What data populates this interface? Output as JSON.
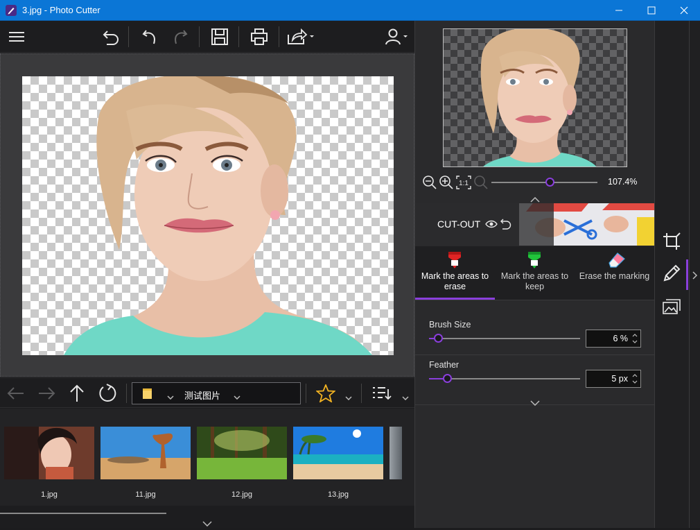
{
  "window": {
    "title": "3.jpg - Photo Cutter",
    "app_icon": "photo-cutter-pen-icon"
  },
  "toolbar": {
    "icons": [
      "menu-icon",
      "undo-all-icon",
      "undo-icon",
      "redo-icon",
      "save-icon",
      "print-icon",
      "share-icon",
      "user-icon"
    ]
  },
  "navigation": {
    "folder_name": "测试图片",
    "icons": [
      "back-arrow-icon",
      "forward-arrow-icon",
      "up-arrow-icon",
      "refresh-icon",
      "folder-icon",
      "star-icon",
      "sort-icon"
    ]
  },
  "thumbnails": [
    {
      "label": "1.jpg"
    },
    {
      "label": "11.jpg"
    },
    {
      "label": "12.jpg"
    },
    {
      "label": "13.jpg"
    }
  ],
  "preview": {
    "zoom": "107.4%",
    "zoom_fraction": 0.55
  },
  "cutout": {
    "title": "CUT-OUT"
  },
  "modes": [
    {
      "label": "Mark the areas to erase",
      "active": true,
      "color": "#e02424"
    },
    {
      "label": "Mark the areas to keep",
      "active": false,
      "color": "#21c43b"
    },
    {
      "label": "Erase the marking",
      "active": false,
      "color": "#ff7b9c"
    }
  ],
  "brush": {
    "label": "Brush Size",
    "value": "6 %",
    "fraction": 0.06
  },
  "feather": {
    "label": "Feather",
    "value": "5 px",
    "fraction": 0.12
  },
  "sidebar": {
    "icons": [
      "crop-icon",
      "pencil-icon",
      "image-icon"
    ]
  },
  "colors": {
    "accent": "#8a3fdc",
    "titlebar": "#0b76d6"
  }
}
